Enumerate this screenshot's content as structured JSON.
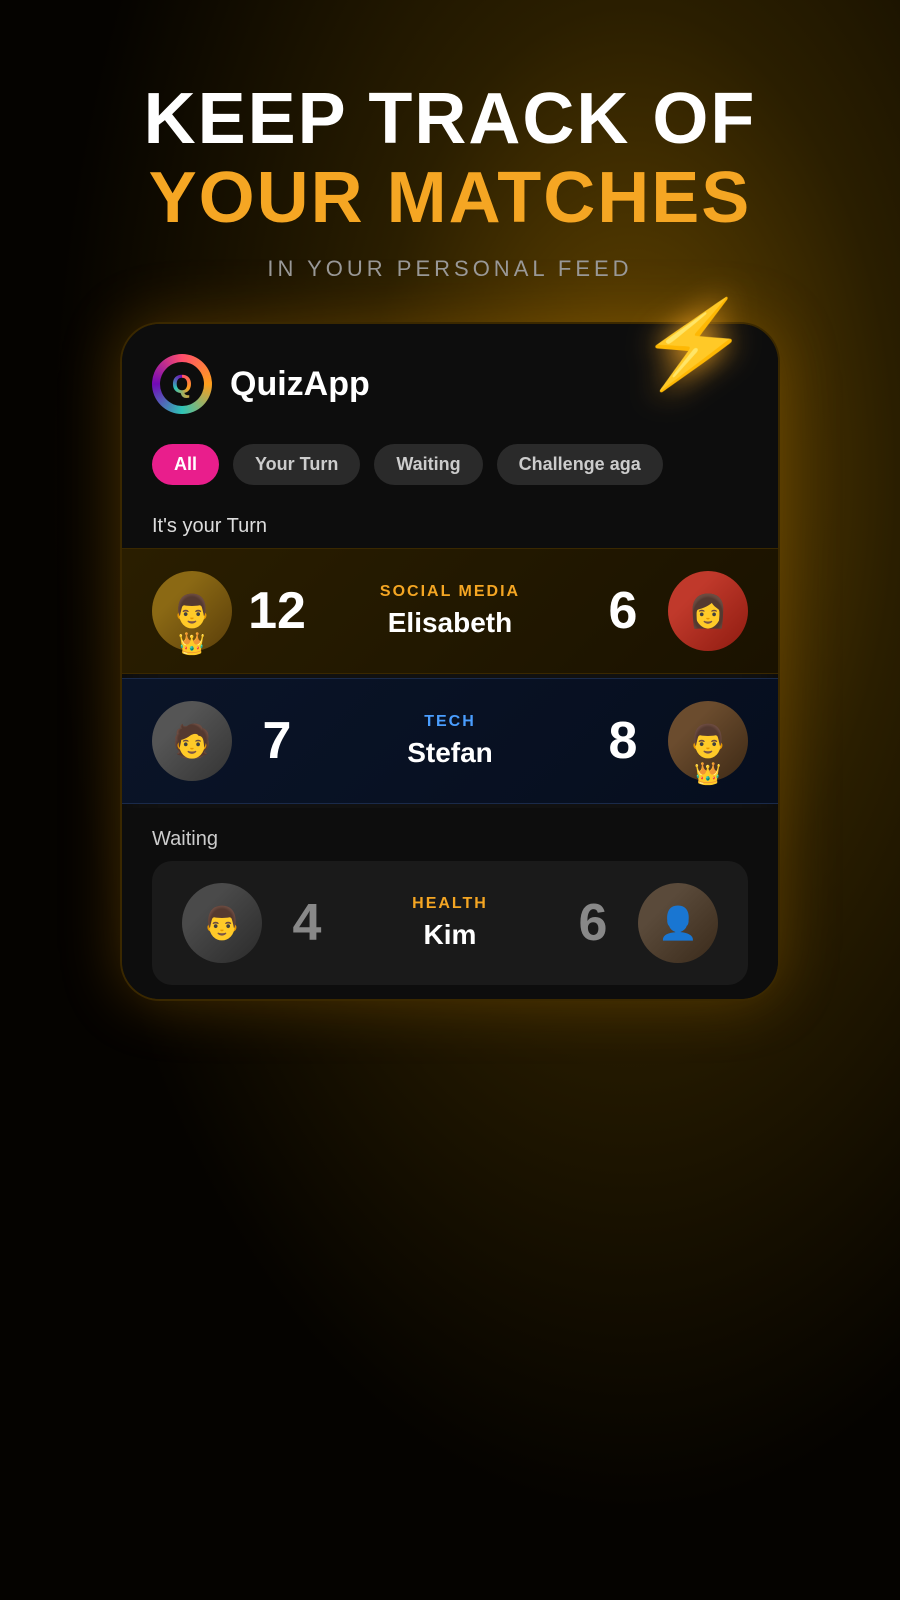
{
  "header": {
    "line1": "KEEP TRACK OF",
    "line2": "YOUR MATCHES",
    "subtitle": "IN YOUR PERSONAL FEED"
  },
  "app": {
    "name": "QuizApp",
    "logo_letter": "Q"
  },
  "tabs": [
    {
      "label": "All",
      "active": true
    },
    {
      "label": "Your Turn",
      "active": false
    },
    {
      "label": "Waiting",
      "active": false
    },
    {
      "label": "Challenge aga",
      "active": false
    }
  ],
  "your_turn_label": "It's your Turn",
  "matches_your_turn": [
    {
      "my_score": "12",
      "category": "SOCIAL MEDIA",
      "opponent": "Elisabeth",
      "opponent_score": "6",
      "my_has_crown": true,
      "opp_has_crown": false
    },
    {
      "my_score": "7",
      "category": "TECH",
      "opponent": "Stefan",
      "opponent_score": "8",
      "my_has_crown": false,
      "opp_has_crown": true
    }
  ],
  "waiting_label": "Waiting",
  "matches_waiting": [
    {
      "my_score": "4",
      "category": "HEALTH",
      "opponent": "Kim",
      "opponent_score": "6",
      "my_has_crown": false,
      "opp_has_crown": false
    }
  ],
  "lightning": "⚡"
}
